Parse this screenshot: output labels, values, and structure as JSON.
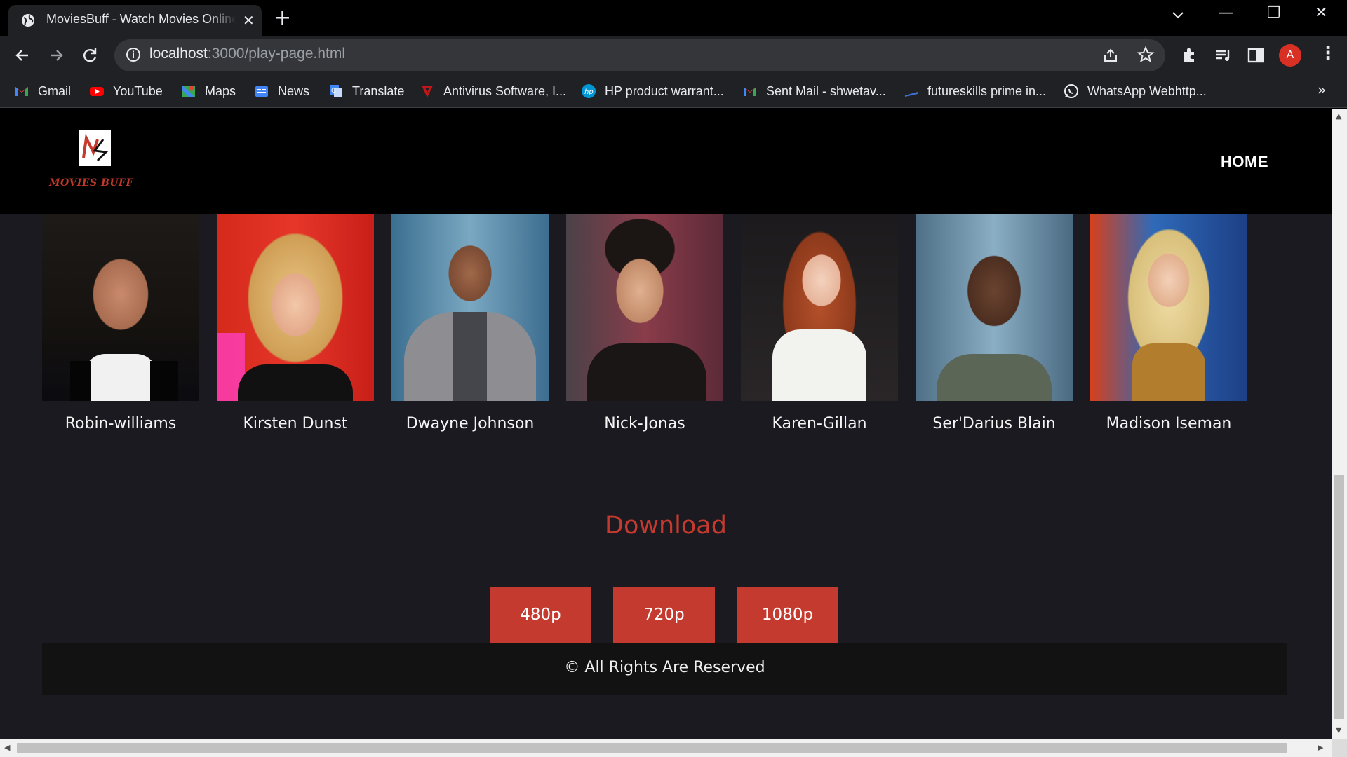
{
  "browser": {
    "tab_title": "MoviesBuff - Watch Movies Online",
    "tab_close": "✕",
    "new_tab": "+",
    "url_host": "localhost",
    "url_path": ":3000/play-page.html",
    "profile_initial": "A",
    "window_controls": {
      "minimize": "—",
      "restore": "❐",
      "close": "✕"
    },
    "bookmarks": [
      {
        "label": "Gmail",
        "icon": "gmail-icon"
      },
      {
        "label": "YouTube",
        "icon": "youtube-icon"
      },
      {
        "label": "Maps",
        "icon": "maps-icon"
      },
      {
        "label": "News",
        "icon": "news-icon"
      },
      {
        "label": "Translate",
        "icon": "translate-icon"
      },
      {
        "label": "Antivirus Software, I...",
        "icon": "antivirus-icon"
      },
      {
        "label": "HP product warrant...",
        "icon": "hp-icon"
      },
      {
        "label": "Sent Mail - shwetav...",
        "icon": "gmail-icon"
      },
      {
        "label": "futureskills prime in...",
        "icon": "futureskills-icon"
      },
      {
        "label": "WhatsApp Webhttp...",
        "icon": "whatsapp-icon"
      }
    ],
    "bookmarks_more": "»"
  },
  "site": {
    "logo_text": "MOVIES BUFF",
    "nav": {
      "home": "HOME"
    },
    "cast": [
      {
        "name": "Robin-williams"
      },
      {
        "name": "Kirsten Dunst"
      },
      {
        "name": "Dwayne Johnson"
      },
      {
        "name": "Nick-Jonas"
      },
      {
        "name": "Karen-Gillan"
      },
      {
        "name": "Ser'Darius Blain"
      },
      {
        "name": "Madison Iseman"
      }
    ],
    "download": {
      "title": "Download",
      "options": [
        "480p",
        "720p",
        "1080p"
      ]
    },
    "footer": "© All Rights Are Reserved"
  },
  "colors": {
    "accent": "#c53a2e",
    "page_bg": "#1a1a20",
    "header_bg": "#000000",
    "footer_bg": "#121212"
  }
}
